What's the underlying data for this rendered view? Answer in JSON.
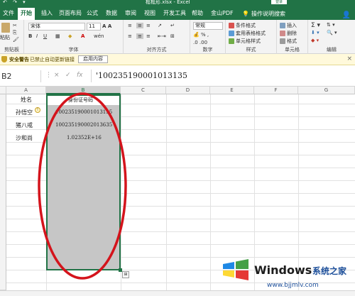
{
  "titlebar": {
    "document_title": "框框形.xlsx - Excel",
    "login_label": "登录"
  },
  "ribbon_tabs": [
    {
      "label": "文件"
    },
    {
      "label": "开始"
    },
    {
      "label": "插入"
    },
    {
      "label": "页面布局"
    },
    {
      "label": "公式"
    },
    {
      "label": "数据"
    },
    {
      "label": "审阅"
    },
    {
      "label": "视图"
    },
    {
      "label": "开发工具"
    },
    {
      "label": "帮助"
    },
    {
      "label": "金山PDF"
    },
    {
      "label": "操作说明搜索"
    }
  ],
  "ribbon": {
    "clipboard": {
      "paste_label": "粘贴",
      "group_label": "剪贴板"
    },
    "font": {
      "font_name": "宋体",
      "font_size": "11",
      "group_label": "字体"
    },
    "alignment": {
      "group_label": "对齐方式"
    },
    "number": {
      "format": "常规",
      "group_label": "数字"
    },
    "styles": {
      "conditional_format": "条件格式",
      "table_format": "套用表格格式",
      "cell_styles": "单元格样式",
      "group_label": "样式"
    },
    "cells": {
      "insert": "插入",
      "delete": "删除",
      "format": "格式",
      "group_label": "单元格"
    },
    "editing": {
      "group_label": "编辑"
    }
  },
  "security_bar": {
    "title": "安全警告",
    "message": "已禁止自动更新链接",
    "button_label": "启用内容"
  },
  "formula_bar": {
    "name_box": "B2",
    "cancel": "×",
    "enter": "✓",
    "fx": "fx",
    "content": "'100235190001013135"
  },
  "grid": {
    "columns": [
      "A",
      "B",
      "C",
      "D",
      "E",
      "F",
      "G"
    ],
    "rows": [
      {
        "a": "姓名",
        "b": "身份证号码"
      },
      {
        "a": "孙悟空",
        "b": "100235190001013135"
      },
      {
        "a": "猪八戒",
        "b": "100235190002013635"
      },
      {
        "a": "沙和尚",
        "b": "1.02352E+16"
      }
    ]
  },
  "watermark": {
    "brand": "Windows",
    "subtitle": "系统之家",
    "url": "www.bjjmlv.com"
  },
  "colors": {
    "excel_green": "#217346",
    "selection_gray": "#c6c6c6",
    "annotation_red": "#d4141c",
    "security_yellow": "#fff9db"
  }
}
